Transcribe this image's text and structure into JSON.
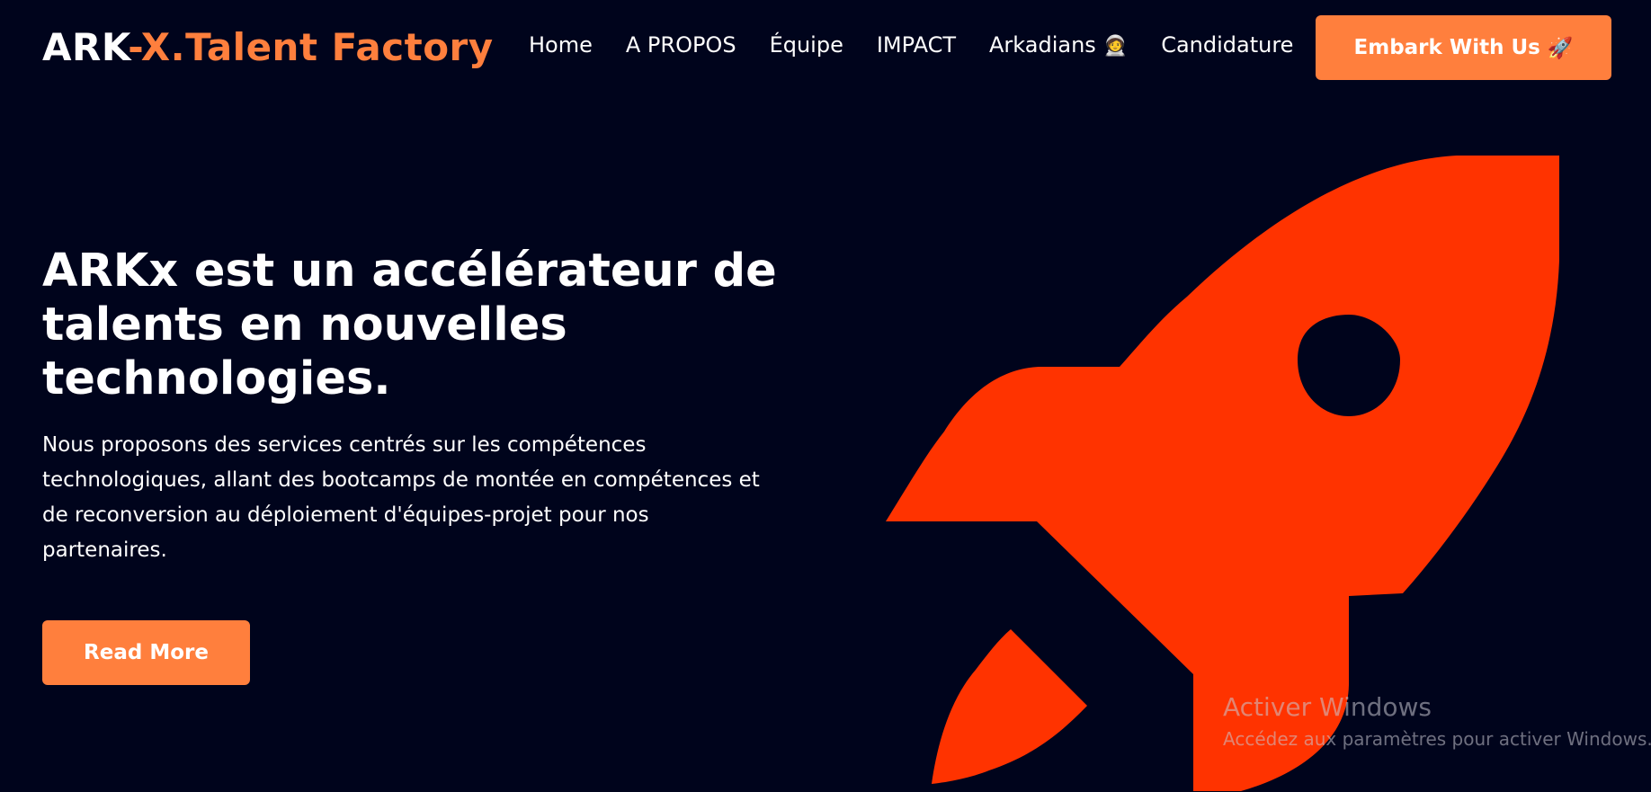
{
  "header": {
    "logo_part1": "ARK",
    "logo_part2": "-X.Talent Factory",
    "nav": [
      {
        "label": "Home"
      },
      {
        "label": "A PROPOS"
      },
      {
        "label": "Équipe"
      },
      {
        "label": "IMPACT"
      },
      {
        "label": "Arkadians",
        "emoji": "🧑‍🚀"
      },
      {
        "label": "Candidature"
      }
    ],
    "cta_label": "Embark With Us",
    "cta_emoji": "🚀"
  },
  "hero": {
    "title": "ARKx est un accélérateur de talents en nouvelles technologies.",
    "description": "Nous proposons des services centrés sur les compétences technologiques, allant des bootcamps de montée en compétences et de reconversion au déploiement d'équipes-projet pour nos partenaires.",
    "button_label": "Read More"
  },
  "watermark": {
    "title": "Activer Windows",
    "subtitle": "Accédez aux paramètres pour activer Windows."
  },
  "colors": {
    "background": "#00041c",
    "accent": "#ff7f3d",
    "rocket": "#ff3300"
  }
}
